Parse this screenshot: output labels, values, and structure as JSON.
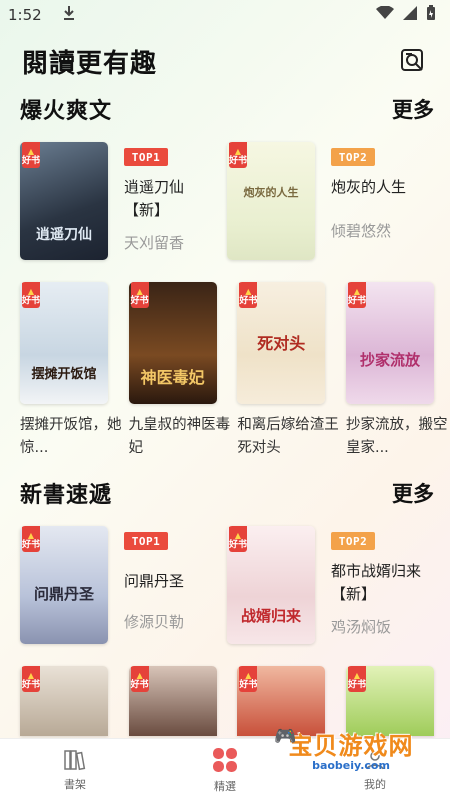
{
  "status": {
    "time": "1:52"
  },
  "header": {
    "title": "閱讀更有趣"
  },
  "sections": [
    {
      "title": "爆火爽文",
      "more": "更多",
      "top": [
        {
          "rank": "TOP1",
          "title": "逍遥刀仙【新】",
          "author": "天刈留香",
          "cover_text": "逍遥刀仙",
          "cover_bg": "#3a4a5c",
          "cover_fg": "#d9e6f2"
        },
        {
          "rank": "TOP2",
          "title": "炮灰的人生",
          "author": "倾碧悠然",
          "cover_text": "炮灰的人生",
          "cover_bg": "#eef2d8",
          "cover_fg": "#7a6a40"
        }
      ],
      "grid": [
        {
          "title": "摆摊开饭馆，她惊...",
          "cover_text": "摆摊开饭馆",
          "cover_bg": "#d8e2ec",
          "cover_fg": "#222"
        },
        {
          "title": "九皇叔的神医毒妃",
          "cover_text": "神医毒妃",
          "cover_bg": "#5a3a22",
          "cover_fg": "#f3c766"
        },
        {
          "title": "和离后嫁给渣王死对头",
          "cover_text": "死对头",
          "cover_bg": "#f3ead8",
          "cover_fg": "#b02c22"
        },
        {
          "title": "抄家流放，搬空皇家...",
          "cover_text": "抄家流放",
          "cover_bg": "#e8d2e6",
          "cover_fg": "#b0306c"
        }
      ]
    },
    {
      "title": "新書速遞",
      "more": "更多",
      "top": [
        {
          "rank": "TOP1",
          "title": "问鼎丹圣",
          "author": "修源贝勒",
          "cover_text": "问鼎丹圣",
          "cover_bg": "#cfd6e6",
          "cover_fg": "#2a2a3a"
        },
        {
          "rank": "TOP2",
          "title": "都市战婿归来【新】",
          "author": "鸡汤焖饭",
          "cover_text": "战婿归来",
          "cover_bg": "#f4e8ea",
          "cover_fg": "#c0282c"
        }
      ],
      "grid": [
        {
          "cover_bg": "#d9cfc2"
        },
        {
          "cover_bg": "#c9b4a8"
        },
        {
          "cover_bg": "#e9a08a"
        },
        {
          "cover_bg": "#cfe8a0"
        }
      ]
    }
  ],
  "nav": [
    {
      "label": "書架",
      "icon": "bookshelf-icon"
    },
    {
      "label": "精選",
      "icon": "clover-icon"
    },
    {
      "label": "我的",
      "icon": "profile-icon"
    }
  ],
  "badge_label": "好书",
  "watermark": {
    "text": "宝贝游戏网",
    "sub": "baobeiy.com"
  },
  "colors": {
    "accent": "#ea5a5a",
    "rank1": "#ea4b3d",
    "rank2": "#f3a24a"
  }
}
